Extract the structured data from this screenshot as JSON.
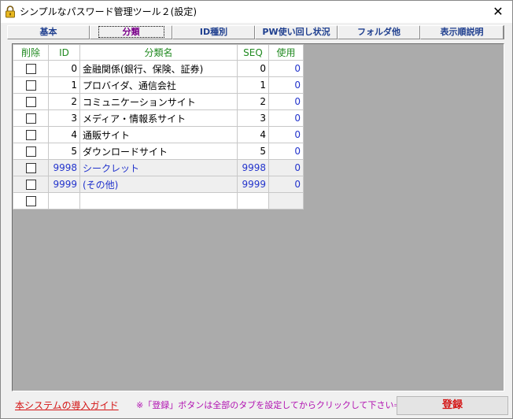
{
  "window": {
    "title": "シンプルなパスワード管理ツール２(設定)",
    "close_label": "✕"
  },
  "tabs": [
    {
      "label": "基本"
    },
    {
      "label": "分類",
      "active": true
    },
    {
      "label": "ID種別"
    },
    {
      "label": "PW使い回し状況"
    },
    {
      "label": "フォルダ他"
    },
    {
      "label": "表示順説明"
    }
  ],
  "grid": {
    "headers": {
      "delete": "削除",
      "id": "ID",
      "name": "分類名",
      "seq": "SEQ",
      "use": "使用"
    },
    "rows": [
      {
        "id": "0",
        "name": "金融関係(銀行、保険、証券)",
        "seq": "0",
        "use": "0"
      },
      {
        "id": "1",
        "name": "プロバイダ、通信会社",
        "seq": "1",
        "use": "0"
      },
      {
        "id": "2",
        "name": "コミュニケーションサイト",
        "seq": "2",
        "use": "0"
      },
      {
        "id": "3",
        "name": "メディア・情報系サイト",
        "seq": "3",
        "use": "0"
      },
      {
        "id": "4",
        "name": "通販サイト",
        "seq": "4",
        "use": "0"
      },
      {
        "id": "5",
        "name": "ダウンロードサイト",
        "seq": "5",
        "use": "0"
      },
      {
        "id": "9998",
        "name": "シークレット",
        "seq": "9998",
        "use": "0"
      },
      {
        "id": "9999",
        "name": "(その他)",
        "seq": "9999",
        "use": "0"
      },
      {
        "id": "",
        "name": "",
        "seq": "",
        "use": ""
      }
    ]
  },
  "footer": {
    "guide_link": "本システムの導入ガイド",
    "note": "※「登録」ボタンは全部のタブを設定してからクリックして下さい⇒",
    "register_label": "登録"
  },
  "colors": {
    "panel_bg": "#ababab",
    "header_text": "#218a21",
    "value_blue": "#2233cc",
    "link_red": "#d41414",
    "note_purple": "#b010b0",
    "active_tab": "#7a008a",
    "tab_text": "#1f3f8f"
  },
  "icons": {
    "title": "lock-icon"
  }
}
